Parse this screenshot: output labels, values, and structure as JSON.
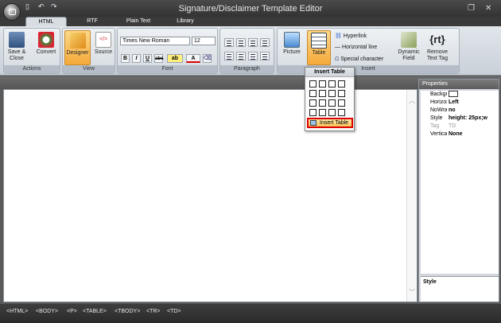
{
  "window": {
    "title": "Signature/Disclaimer Template Editor"
  },
  "tabs": [
    "HTML",
    "RTF",
    "Plain Text",
    "Library"
  ],
  "ribbon": {
    "groups": [
      "Actions",
      "View",
      "Font",
      "Paragraph",
      "Insert"
    ],
    "actions": {
      "save_close": "Save & Close",
      "convert": "Convert"
    },
    "view": {
      "designer": "Designer",
      "source": "Source"
    },
    "font": {
      "family": "Times New Roman",
      "size": "12"
    },
    "insert": {
      "picture": "Picture",
      "table": "Table",
      "hyperlink": "Hyperlink",
      "horizontal_line": "Horizontal line",
      "special_character": "Special character",
      "dynamic_field": "Dynamic Field",
      "remove_text_tag": "Remove Text Tag",
      "rt_icon": "{rt}"
    }
  },
  "dropdown": {
    "title": "Insert Table",
    "insert_button": "Insert Table"
  },
  "properties": {
    "title": "Properties",
    "rows": [
      {
        "key": "Backgrou",
        "value": ""
      },
      {
        "key": "Horizonta",
        "value": "Left"
      },
      {
        "key": "NoWrap",
        "value": "no"
      },
      {
        "key": "Style",
        "value": "height: 25px;w"
      },
      {
        "key": "Tag",
        "value": "TD"
      },
      {
        "key": "Vertical a",
        "value": "None"
      }
    ],
    "style_label": "Style"
  },
  "status_tags": [
    "<HTML>",
    "<BODY>",
    "<P>",
    "<TABLE>",
    "<TBODY>",
    "<TR>",
    "<TD>"
  ]
}
